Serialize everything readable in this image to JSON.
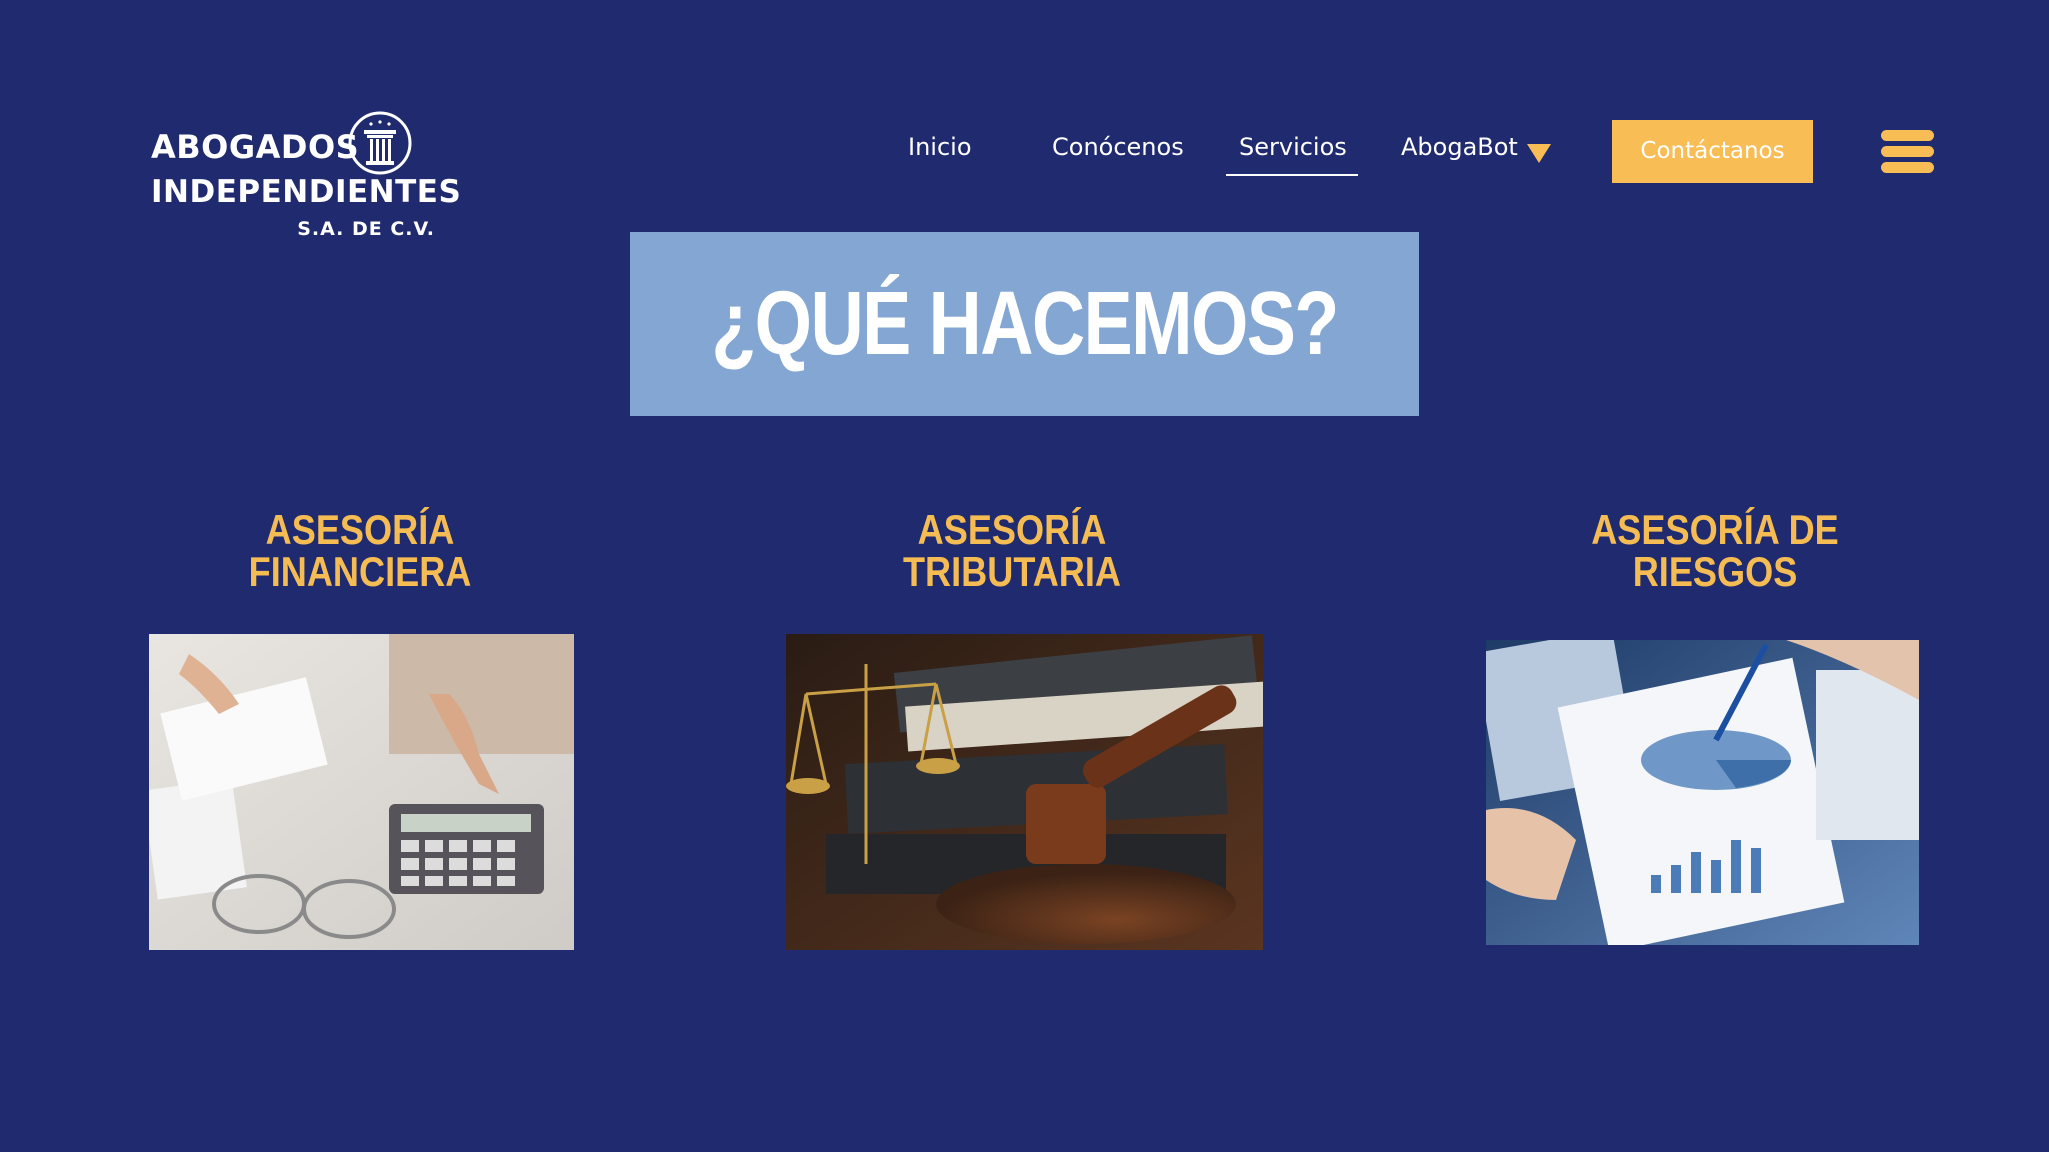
{
  "logo": {
    "line1": "ABOGADOS",
    "line2": "INDEPENDIENTES",
    "line3": "S.A. DE C.V.",
    "emblem_icon": "column-pillar-icon"
  },
  "nav": {
    "items": [
      {
        "label": "Inicio"
      },
      {
        "label": "Conócenos"
      },
      {
        "label": "Servicios",
        "active": true
      },
      {
        "label": "AbogaBot",
        "has_dropdown": true
      }
    ],
    "contact_label": "Contáctanos",
    "menu_icon": "hamburger-menu-icon"
  },
  "heading": {
    "title": "¿QUÉ HACEMOS?"
  },
  "services": [
    {
      "title_line1": "ASESORÍA",
      "title_line2": "FINANCIERA",
      "image_icon": "calculator-photo"
    },
    {
      "title_line1": "ASESORÍA",
      "title_line2": "TRIBUTARIA",
      "image_icon": "gavel-scales-photo"
    },
    {
      "title_line1": "ASESORÍA DE",
      "title_line2": "RIESGOS",
      "image_icon": "charts-documents-photo"
    }
  ],
  "colors": {
    "background": "#1f2a6f",
    "accent": "#f9bd55",
    "heading_box": "#84a6d2",
    "service_title": "#f5bc53",
    "text": "#ffffff"
  }
}
